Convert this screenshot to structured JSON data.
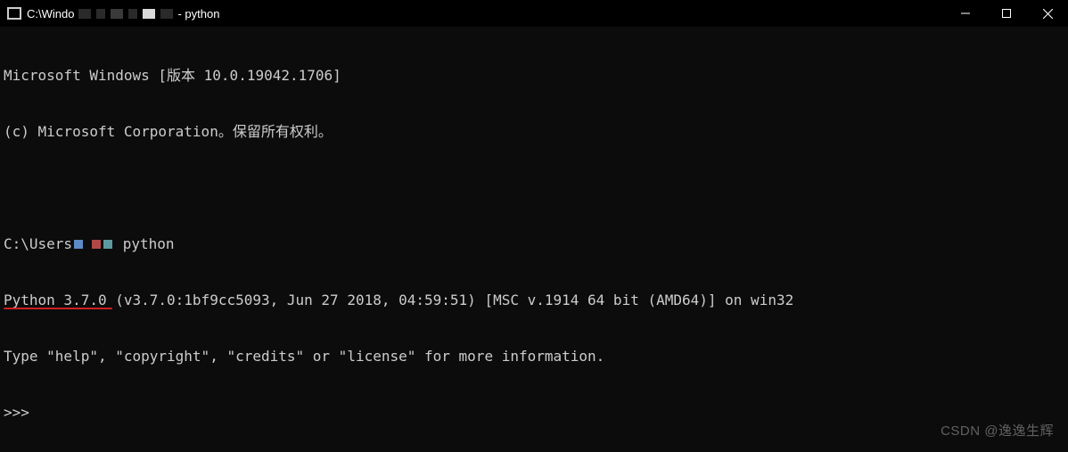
{
  "titlebar": {
    "prefix": "C:\\Windo",
    "suffix": "- python"
  },
  "terminal": {
    "line1": "Microsoft Windows [版本 10.0.19042.1706]",
    "line2": "(c) Microsoft Corporation。保留所有权利。",
    "prompt_prefix": "C:\\Users",
    "prompt_suffix": " python",
    "python_version": "Python 3.7.0",
    "python_build": " (v3.7.0:1bf9cc5093, Jun 27 2018, 04:59:51) [MSC v.1914 64 bit (AMD64)] on win32",
    "help_line": "Type \"help\", \"copyright\", \"credits\" or \"license\" for more information.",
    "repl_prompt": ">>> "
  },
  "watermark": "CSDN @逸逸生辉"
}
